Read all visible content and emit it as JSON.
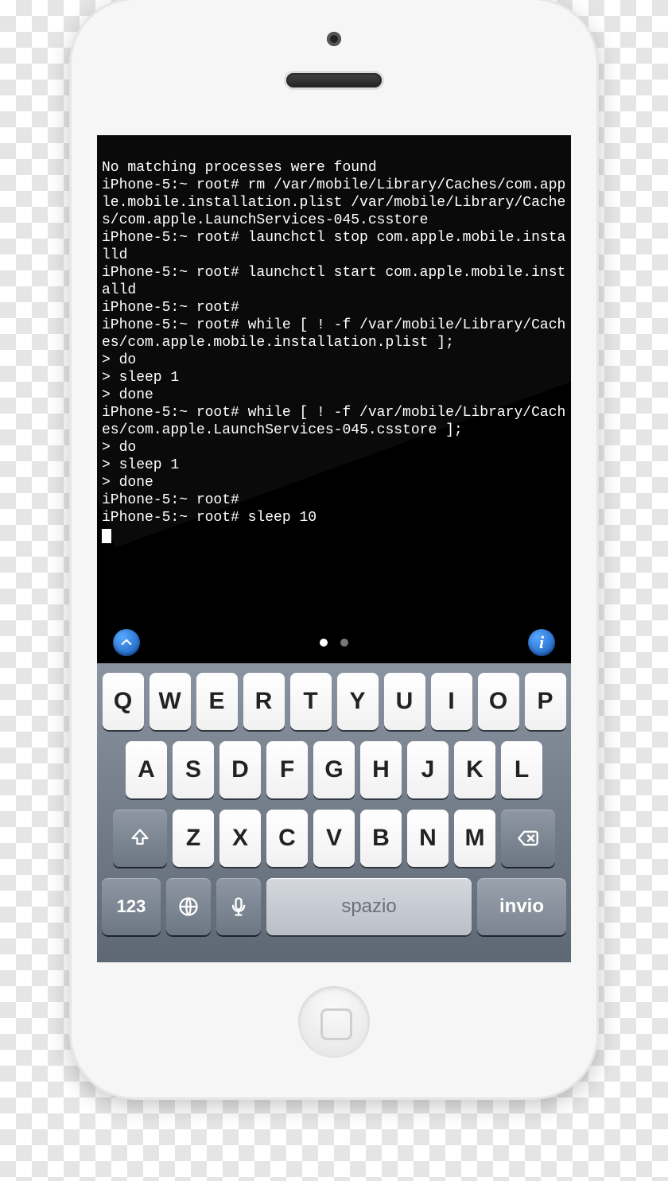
{
  "terminal": {
    "lines": [
      "No matching processes were found",
      "iPhone-5:~ root# rm /var/mobile/Library/Caches/com.apple.mobile.installation.plist /var/mobile/Library/Caches/com.apple.LaunchServices-045.csstore",
      "iPhone-5:~ root# launchctl stop com.apple.mobile.installd",
      "iPhone-5:~ root# launchctl start com.apple.mobile.installd",
      "iPhone-5:~ root#",
      "iPhone-5:~ root# while [ ! -f /var/mobile/Library/Caches/com.apple.mobile.installation.plist ];",
      "> do",
      "> sleep 1",
      "> done",
      "iPhone-5:~ root# while [ ! -f /var/mobile/Library/Caches/com.apple.LaunchServices-045.csstore ];",
      "> do",
      "> sleep 1",
      "> done",
      "iPhone-5:~ root#",
      "iPhone-5:~ root# sleep 10"
    ]
  },
  "toolbar": {
    "info_label": "i"
  },
  "keyboard": {
    "row1": [
      "Q",
      "W",
      "E",
      "R",
      "T",
      "Y",
      "U",
      "I",
      "O",
      "P"
    ],
    "row2": [
      "A",
      "S",
      "D",
      "F",
      "G",
      "H",
      "J",
      "K",
      "L"
    ],
    "row3": [
      "Z",
      "X",
      "C",
      "V",
      "B",
      "N",
      "M"
    ],
    "numbers": "123",
    "space": "spazio",
    "enter": "invio"
  }
}
